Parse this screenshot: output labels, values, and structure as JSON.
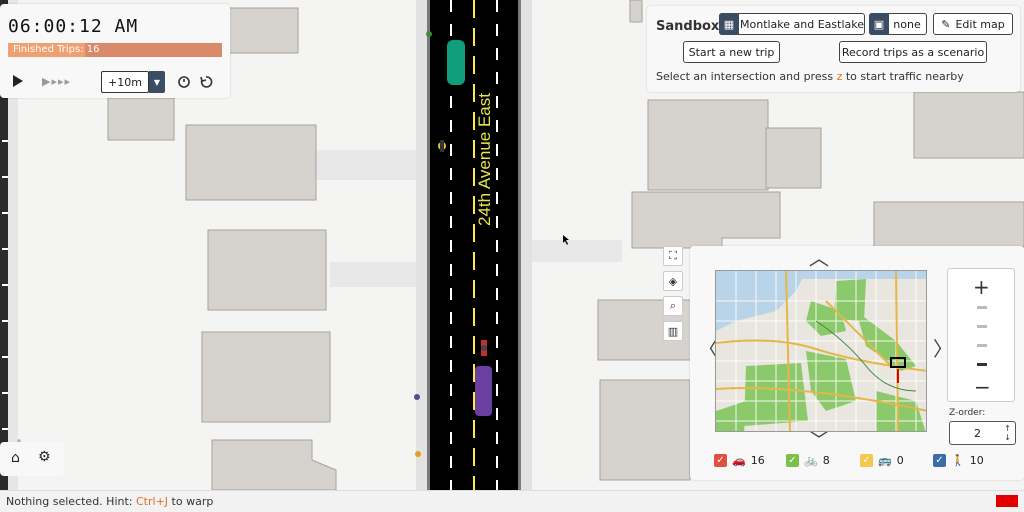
{
  "colors": {
    "map_bg": "#f4f4f2",
    "sidewalk": "#e2e2e2",
    "building": "#d6d3ce",
    "building_stroke": "#a8a29b",
    "road": "#000000",
    "lane_line": "#ffffff",
    "center_line": "#ffeb3b",
    "accent": "#3a4d62",
    "trips_bar": "#f0a070",
    "car_green": "#0f9d7a",
    "car_purple": "#6b3fa0"
  },
  "time_panel": {
    "clock": "06:00:12 AM",
    "finished_trips_label": "Finished Trips: 16",
    "progress_fraction": 0.36,
    "play_icon": "play-icon",
    "step_glyphs": "▶▸▸▸",
    "jump_label": "+10m",
    "reset_icon": "reset-icon",
    "undo_icon": "undo-icon"
  },
  "sandbox": {
    "title": "Sandbox",
    "region_label": "Montlake and Eastlake",
    "scenario_label": "none",
    "edit_map_label": "Edit map",
    "new_trip_label": "Start a new trip",
    "record_label": "Record trips as a scenario",
    "hint_prefix": "Select an intersection and press",
    "hint_key": "z",
    "hint_suffix": "to start traffic nearby"
  },
  "map": {
    "street_name": "24th Avenue East"
  },
  "minimap": {
    "zorder_label": "Z-order:",
    "zorder_value": "2",
    "legend": [
      {
        "name": "cars",
        "icon": "car-icon",
        "glyph": "🚗",
        "count": "16",
        "color": "#e05040"
      },
      {
        "name": "bikes",
        "icon": "bike-icon",
        "glyph": "🚲",
        "count": "8",
        "color": "#7cc04a"
      },
      {
        "name": "buses",
        "icon": "bus-icon",
        "glyph": "🚌",
        "count": "0",
        "color": "#f2c94c"
      },
      {
        "name": "pedestrians",
        "icon": "pedestrian-icon",
        "glyph": "🚶",
        "count": "10",
        "color": "#3a6ea5"
      }
    ]
  },
  "status": {
    "prefix": "Nothing selected. Hint:",
    "key": "Ctrl+J",
    "suffix": "to warp"
  }
}
